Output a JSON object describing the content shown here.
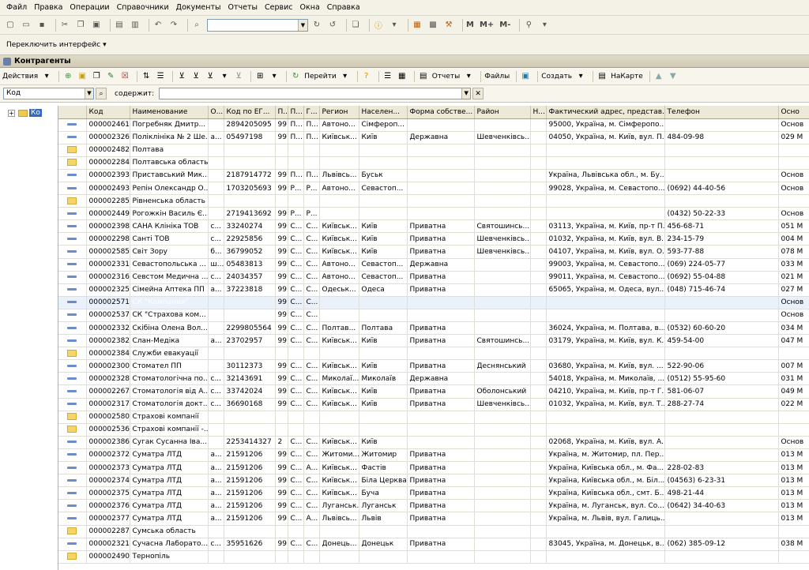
{
  "menu": [
    "Файл",
    "Правка",
    "Операции",
    "Справочники",
    "Документы",
    "Отчеты",
    "Сервис",
    "Окна",
    "Справка"
  ],
  "toolbar": {
    "m_label": "М",
    "mplus_label": "М+",
    "mminus_label": "М-"
  },
  "interface_switch": "Переключить интерфейс",
  "window_title": "Контрагенты",
  "actions": {
    "actions_label": "Действия",
    "go_label": "Перейти",
    "reports_label": "Отчеты",
    "files_label": "Файлы",
    "create_label": "Создать",
    "map_label": "НаКарте"
  },
  "filter": {
    "field": "Код",
    "contains_label": "содержит:",
    "value": ""
  },
  "tree": {
    "node_label": "Ко"
  },
  "columns": [
    "",
    "Код",
    "Наименование",
    "О...",
    "Код по ЕГ...",
    "П...",
    "П...",
    "Г...",
    "Регион",
    "Населен...",
    "Форма собстве...",
    "Район",
    "Н...",
    "Фактический адрес, представ...",
    "Телефон",
    "Осно"
  ],
  "rows": [
    {
      "t": "i",
      "c": [
        "000002461",
        "Погребняк Дмитр...",
        "",
        "2894205095",
        "99",
        "П...",
        "П...",
        "Автоно...",
        "Сімфероп...",
        "",
        "",
        "",
        "95000, Україна, м. Сімферопо...",
        "",
        "Основ"
      ]
    },
    {
      "t": "i",
      "c": [
        "000002326",
        "Поліклініка № 2 Ше...",
        "а...",
        "05497198",
        "99",
        "П...",
        "П...",
        "Київськ...",
        "Київ",
        "Державна",
        "Шевченківсь...",
        "",
        "04050, Україна, м. Київ, вул. П...",
        "484-09-98",
        "029 М"
      ]
    },
    {
      "t": "f",
      "c": [
        "000002482",
        "Полтава",
        "",
        "",
        "",
        "",
        "",
        "",
        "",
        "",
        "",
        "",
        "",
        "",
        ""
      ]
    },
    {
      "t": "f",
      "c": [
        "000002284",
        "Полтавська область",
        "",
        "",
        "",
        "",
        "",
        "",
        "",
        "",
        "",
        "",
        "",
        "",
        ""
      ]
    },
    {
      "t": "i",
      "c": [
        "000002393",
        "Приставський Мик...",
        "",
        "2187914772",
        "99",
        "П...",
        "П...",
        "Львівсь...",
        "Буськ",
        "",
        "",
        "",
        "Україна, Львівська обл., м. Бу...",
        "",
        "Основ"
      ]
    },
    {
      "t": "i",
      "c": [
        "000002493",
        "Репін Олександр О...",
        "",
        "1703205693",
        "99",
        "Р...",
        "Р...",
        "Автоно...",
        "Севастоп...",
        "",
        "",
        "",
        "99028, Україна, м. Севастопо...",
        "(0692) 44-40-56",
        "Основ"
      ]
    },
    {
      "t": "f",
      "c": [
        "000002285",
        "Рівненська область",
        "",
        "",
        "",
        "",
        "",
        "",
        "",
        "",
        "",
        "",
        "",
        "",
        ""
      ]
    },
    {
      "t": "i",
      "c": [
        "000002449",
        "Рогожкін Василь Є...",
        "",
        "2719413692",
        "99",
        "Р...",
        "Р...",
        "",
        "",
        "",
        "",
        "",
        "",
        "(0432) 50-22-33",
        "Основ"
      ]
    },
    {
      "t": "i",
      "c": [
        "000002398",
        "САНА Клініка ТОВ",
        "с...",
        "33240274",
        "99",
        "С...",
        "С...",
        "Київськ...",
        "Київ",
        "Приватна",
        "Святошинсь...",
        "",
        "03113, Україна, м. Київ, пр-т П...",
        "456-68-71",
        "051 М"
      ]
    },
    {
      "t": "i",
      "c": [
        "000002298",
        "Санті ТОВ",
        "с...",
        "22925856",
        "99",
        "С...",
        "С...",
        "Київськ...",
        "Київ",
        "Приватна",
        "Шевченківсь...",
        "",
        "01032, Україна, м. Київ, вул. В...",
        "234-15-79",
        "004 М"
      ]
    },
    {
      "t": "i",
      "c": [
        "000002585",
        "Світ Зору",
        "б...",
        "36799052",
        "99",
        "С...",
        "С...",
        "Київськ...",
        "Київ",
        "Приватна",
        "Шевченківсь...",
        "",
        "04107, Україна, м. Київ, вул. О...",
        "593-77-88",
        "078 М"
      ]
    },
    {
      "t": "i",
      "c": [
        "000002331",
        "Севастопольська ...",
        "ш...",
        "05483813",
        "99",
        "С...",
        "С...",
        "Автоно...",
        "Севастоп...",
        "Державна",
        "",
        "",
        "99003, Україна, м. Севастопо...",
        "(069) 224-05-77",
        "033 М"
      ]
    },
    {
      "t": "i",
      "c": [
        "000002316",
        "Севстом Медична ...",
        "с...",
        "24034357",
        "99",
        "С...",
        "С...",
        "Автоно...",
        "Севастоп...",
        "Приватна",
        "",
        "",
        "99011, Україна, м. Севастопо...",
        "(0692) 55-04-88",
        "021 М"
      ]
    },
    {
      "t": "i",
      "c": [
        "000002325",
        "Сімейна Аптека ПП",
        "а...",
        "37223818",
        "99",
        "С...",
        "С...",
        "Одеськ...",
        "Одеса",
        "Приватна",
        "",
        "",
        "65065, Україна, м. Одеса, вул....",
        "(048) 715-46-74",
        "027 М"
      ]
    },
    {
      "t": "i",
      "sel": true,
      "c": [
        "000002571",
        "СК \"Компания\"",
        "",
        "",
        "99",
        "С...",
        "С...",
        "",
        "",
        "",
        "",
        "",
        "",
        "",
        "Основ"
      ]
    },
    {
      "t": "i",
      "c": [
        "000002537",
        "СК \"Страхова ком...",
        "",
        "",
        "99",
        "С...",
        "С...",
        "",
        "",
        "",
        "",
        "",
        "",
        "",
        "Основ"
      ]
    },
    {
      "t": "i",
      "c": [
        "000002332",
        "Скібіна Олена Вол...",
        "",
        "2299805564",
        "99",
        "С...",
        "С...",
        "Полтав...",
        "Полтава",
        "Приватна",
        "",
        "",
        "36024, Україна, м. Полтава, в...",
        "(0532) 60-60-20",
        "034 М"
      ]
    },
    {
      "t": "i",
      "c": [
        "000002382",
        "Слан-Медіка",
        "а...",
        "23702957",
        "99",
        "С...",
        "С...",
        "Київськ...",
        "Київ",
        "Приватна",
        "Святошинсь...",
        "",
        "03179, Україна, м. Київ, вул. К...",
        "459-54-00",
        "047 М"
      ]
    },
    {
      "t": "f",
      "c": [
        "000002384",
        "Служби евакуації",
        "",
        "",
        "",
        "",
        "",
        "",
        "",
        "",
        "",
        "",
        "",
        "",
        ""
      ]
    },
    {
      "t": "i",
      "c": [
        "000002300",
        "Стомател ПП",
        "",
        "30112373",
        "99",
        "С...",
        "С...",
        "Київськ...",
        "Київ",
        "Приватна",
        "Деснянський",
        "",
        "03680, Україна, м. Київ, вул. ...",
        "522-90-06",
        "007 М"
      ]
    },
    {
      "t": "i",
      "c": [
        "000002328",
        "Стоматологічна по...",
        "с...",
        "32143691",
        "99",
        "С...",
        "С...",
        "Миколаї...",
        "Миколаїв",
        "Державна",
        "",
        "",
        "54018, Україна, м. Миколаїв, ...",
        "(0512) 55-95-60",
        "031 М"
      ]
    },
    {
      "t": "i",
      "c": [
        "000002267",
        "Стоматологія від А...",
        "с...",
        "33742024",
        "99",
        "С...",
        "С...",
        "Київськ...",
        "Київ",
        "Приватна",
        "Оболонський",
        "",
        "04210, Україна, м. Київ, пр-т Г...",
        "581-06-07",
        "049 М"
      ]
    },
    {
      "t": "i",
      "c": [
        "000002317",
        "Стоматологія докт...",
        "с...",
        "36690168",
        "99",
        "С...",
        "С...",
        "Київськ...",
        "Київ",
        "Приватна",
        "Шевченківсь...",
        "",
        "01032, Україна, м. Київ, вул. Т...",
        "288-27-74",
        "022 М"
      ]
    },
    {
      "t": "f",
      "c": [
        "000002580",
        "Страхові компанії",
        "",
        "",
        "",
        "",
        "",
        "",
        "",
        "",
        "",
        "",
        "",
        "",
        ""
      ]
    },
    {
      "t": "f",
      "c": [
        "000002536",
        "Страхові компанії -...",
        "",
        "",
        "",
        "",
        "",
        "",
        "",
        "",
        "",
        "",
        "",
        "",
        ""
      ]
    },
    {
      "t": "i",
      "c": [
        "000002386",
        "Сугак Сусанна Іва...",
        "",
        "2253414327",
        "2",
        "С...",
        "С...",
        "Київськ...",
        "Київ",
        "",
        "",
        "",
        "02068, Україна, м. Київ, вул. А...",
        "",
        "Основ"
      ]
    },
    {
      "t": "i",
      "c": [
        "000002372",
        "Суматра ЛТД",
        "а...",
        "21591206",
        "99",
        "С...",
        "С...",
        "Житоми...",
        "Житомир",
        "Приватна",
        "",
        "",
        "Україна, м. Житомир, пл. Пер...",
        "",
        "013 М"
      ]
    },
    {
      "t": "i",
      "c": [
        "000002373",
        "Суматра ЛТД",
        "а...",
        "21591206",
        "99",
        "С...",
        "А...",
        "Київськ...",
        "Фастів",
        "Приватна",
        "",
        "",
        "Україна, Київська обл., м. Фа...",
        "228-02-83",
        "013 М"
      ]
    },
    {
      "t": "i",
      "c": [
        "000002374",
        "Суматра ЛТД",
        "а...",
        "21591206",
        "99",
        "С...",
        "С...",
        "Київськ...",
        "Біла Церква",
        "Приватна",
        "",
        "",
        "Україна, Київська обл., м. Біл...",
        "(04563) 6-23-31",
        "013 М"
      ]
    },
    {
      "t": "i",
      "c": [
        "000002375",
        "Суматра ЛТД",
        "а...",
        "21591206",
        "99",
        "С...",
        "С...",
        "Київськ...",
        "Буча",
        "Приватна",
        "",
        "",
        "Україна, Київська обл., смт. Б...",
        "498-21-44",
        "013 М"
      ]
    },
    {
      "t": "i",
      "c": [
        "000002376",
        "Суматра ЛТД",
        "а...",
        "21591206",
        "99",
        "С...",
        "С...",
        "Луганськ...",
        "Луганськ",
        "Приватна",
        "",
        "",
        "Україна, м. Луганськ, вул. Со...",
        "(0642) 34-40-63",
        "013 М"
      ]
    },
    {
      "t": "i",
      "c": [
        "000002377",
        "Суматра ЛТД",
        "а...",
        "21591206",
        "99",
        "С...",
        "А...",
        "Львівсь...",
        "Львів",
        "Приватна",
        "",
        "",
        "Україна, м. Львів, вул. Галиць...",
        "",
        "013 М"
      ]
    },
    {
      "t": "f",
      "c": [
        "000002287",
        "Сумська область",
        "",
        "",
        "",
        "",
        "",
        "",
        "",
        "",
        "",
        "",
        "",
        "",
        ""
      ]
    },
    {
      "t": "i",
      "c": [
        "000002321",
        "Сучасна Лаборато...",
        "с...",
        "35951626",
        "99",
        "С...",
        "С...",
        "Донець...",
        "Донецьк",
        "Приватна",
        "",
        "",
        "83045, Україна, м. Донецьк, в...",
        "(062) 385-09-12",
        "038 М"
      ]
    },
    {
      "t": "f",
      "c": [
        "000002490",
        "Тернопіль",
        "",
        "",
        "",
        "",
        "",
        "",
        "",
        "",
        "",
        "",
        "",
        "",
        ""
      ]
    }
  ]
}
